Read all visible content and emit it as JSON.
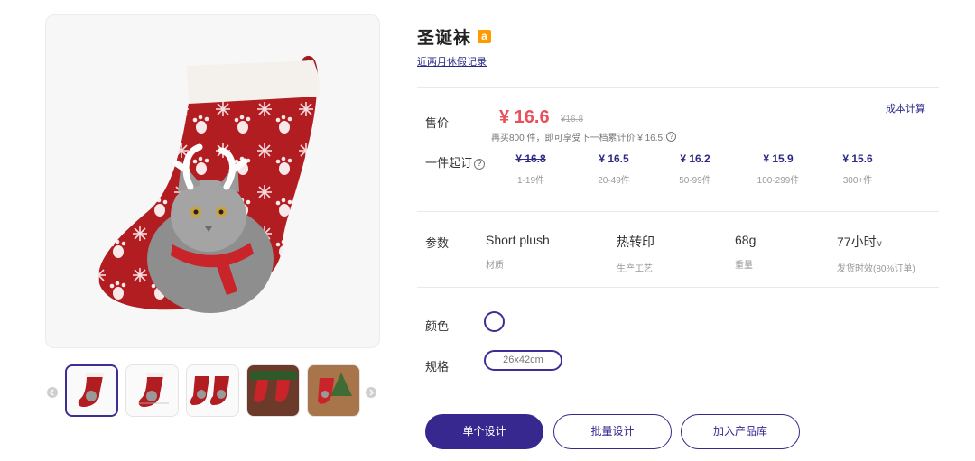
{
  "product": {
    "title": "圣诞袜",
    "badge_icon": "amazon-icon",
    "badge_letter": "a",
    "holiday_link": "近两月休假记录"
  },
  "gallery": {
    "main_image": "christmas-stocking-cat-image",
    "thumbnails": [
      {
        "name": "thumb-stocking-front",
        "active": true
      },
      {
        "name": "thumb-stocking-tag"
      },
      {
        "name": "thumb-stocking-pair"
      },
      {
        "name": "thumb-stocking-scene"
      },
      {
        "name": "thumb-stocking-tree"
      }
    ],
    "prev_icon": "chevron-left-icon",
    "next_icon": "chevron-right-icon"
  },
  "pricing": {
    "label": "售价",
    "price": "¥ 16.6",
    "old_price": "¥16.8",
    "cost_link": "成本计算",
    "promo": "再买800 件，即可享受下一档累计价 ¥ 16.5",
    "moq_label": "一件起订",
    "tiers": [
      {
        "price": "¥ 16.8",
        "range": "1-19件",
        "strike": true
      },
      {
        "price": "¥ 16.5",
        "range": "20-49件"
      },
      {
        "price": "¥ 16.2",
        "range": "50-99件"
      },
      {
        "price": "¥ 15.9",
        "range": "100-299件"
      },
      {
        "price": "¥ 15.6",
        "range": "300+件"
      }
    ]
  },
  "params": {
    "label": "参数",
    "items": [
      {
        "value": "Short plush",
        "key": "材质"
      },
      {
        "value": "热转印",
        "key": "生产工艺"
      },
      {
        "value": "68g",
        "key": "重量"
      },
      {
        "value": "77小时",
        "key": "发货时效(80%订单)"
      }
    ]
  },
  "options": {
    "color_label": "颜色",
    "spec_label": "规格",
    "spec_value": "26x42cm"
  },
  "actions": {
    "single_design": "单个设计",
    "batch_design": "批量设计",
    "add_library": "加入产品库"
  },
  "colors": {
    "accent": "#37288f",
    "price": "#e8505b",
    "stocking_red": "#b21d22"
  }
}
